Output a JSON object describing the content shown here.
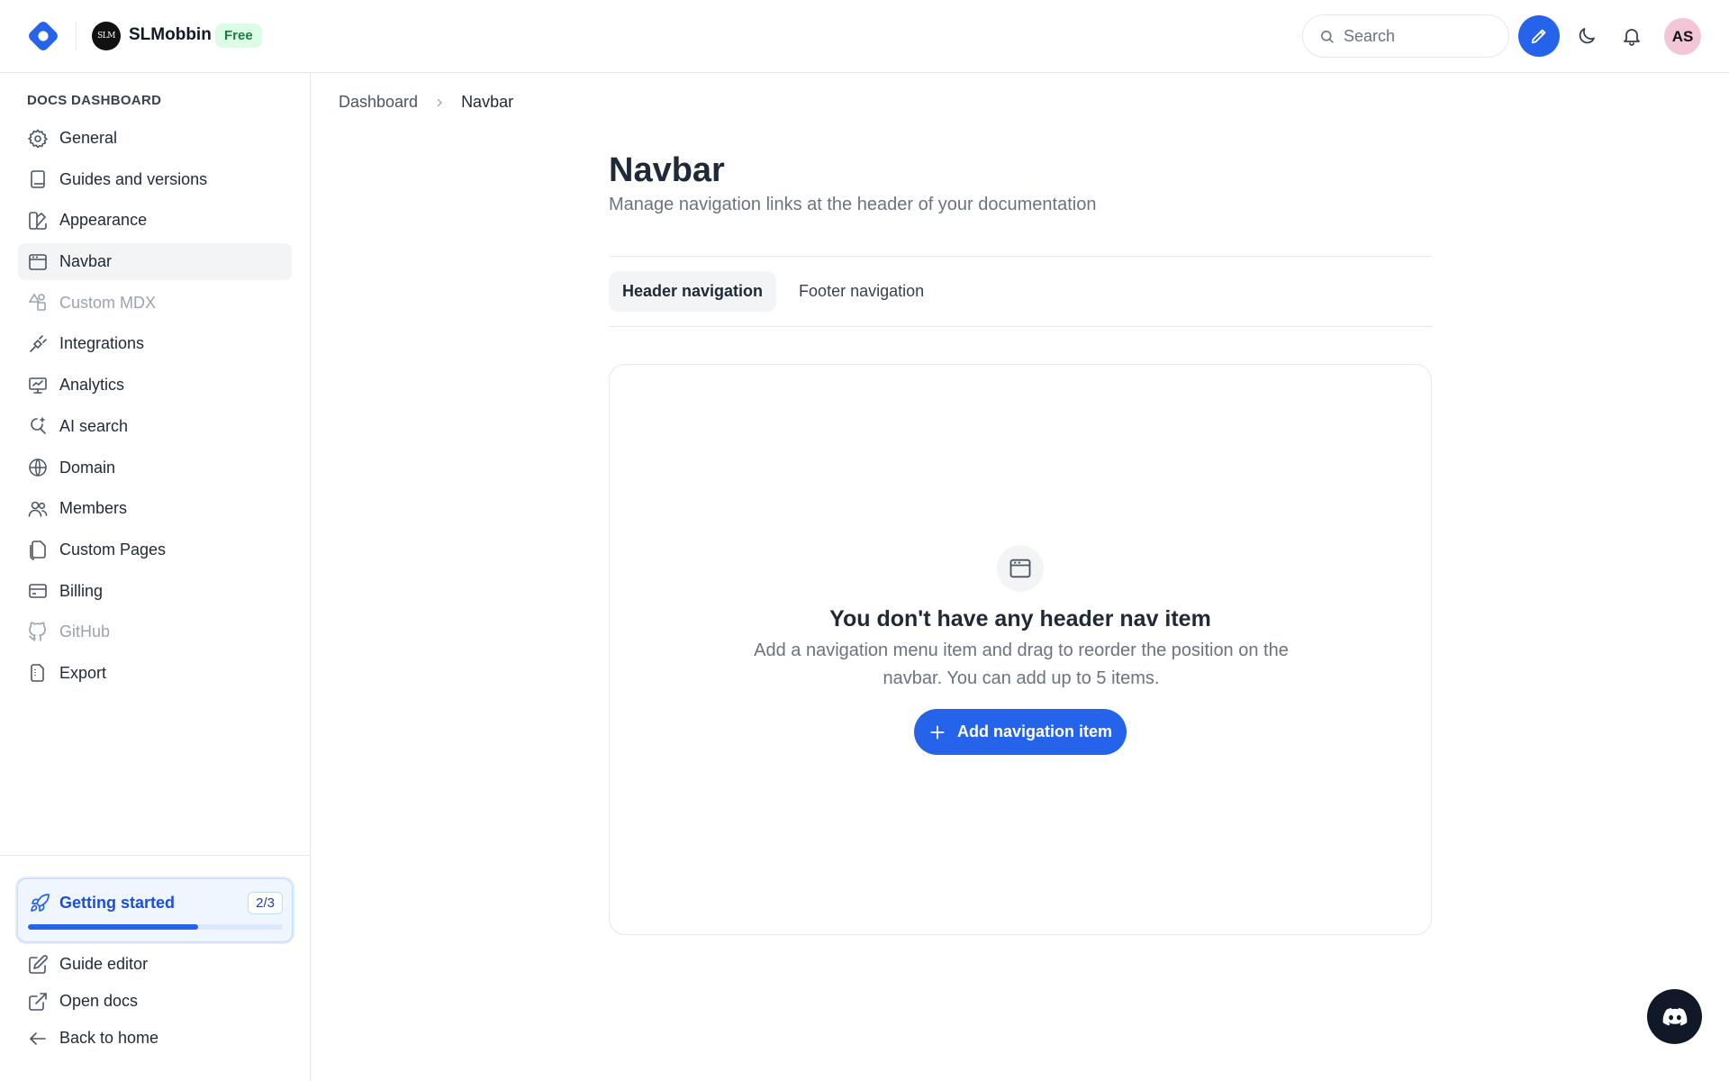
{
  "topbar": {
    "org_initials": "SLM",
    "org_name": "SLMobbin",
    "plan_badge": "Free",
    "search_placeholder": "Search",
    "user_initials": "AS",
    "accent_color": "#2563eb"
  },
  "sidebar": {
    "heading": "DOCS DASHBOARD",
    "items": [
      {
        "label": "General",
        "icon": "gear-icon"
      },
      {
        "label": "Guides and versions",
        "icon": "book-icon"
      },
      {
        "label": "Appearance",
        "icon": "palette-icon"
      },
      {
        "label": "Navbar",
        "icon": "browser-window-icon",
        "active": true
      },
      {
        "label": "Custom MDX",
        "icon": "shapes-icon",
        "disabled": true
      },
      {
        "label": "Integrations",
        "icon": "plug-icon"
      },
      {
        "label": "Analytics",
        "icon": "monitor-chart-icon"
      },
      {
        "label": "AI search",
        "icon": "sparkle-search-icon"
      },
      {
        "label": "Domain",
        "icon": "globe-www-icon"
      },
      {
        "label": "Members",
        "icon": "users-icon"
      },
      {
        "label": "Custom Pages",
        "icon": "pages-icon"
      },
      {
        "label": "Billing",
        "icon": "credit-card-icon"
      },
      {
        "label": "GitHub",
        "icon": "github-icon",
        "disabled": true
      },
      {
        "label": "Export",
        "icon": "file-export-icon"
      }
    ],
    "getting_started": {
      "label": "Getting started",
      "count": "2/3",
      "progress": 0.667
    },
    "bottom_links": [
      {
        "label": "Guide editor",
        "icon": "edit-square-icon"
      },
      {
        "label": "Open docs",
        "icon": "external-link-icon"
      },
      {
        "label": "Back to home",
        "icon": "arrow-left-icon"
      }
    ]
  },
  "breadcrumb": {
    "root": "Dashboard",
    "current": "Navbar"
  },
  "main": {
    "title": "Navbar",
    "subtitle": "Manage navigation links at the header of your documentation",
    "tabs": [
      {
        "label": "Header navigation",
        "active": true
      },
      {
        "label": "Footer navigation"
      }
    ],
    "empty": {
      "title": "You don't have any header nav item",
      "description": "Add a navigation menu item and drag to reorder the position on the navbar. You can add up to 5 items.",
      "button_label": "Add navigation item"
    }
  }
}
